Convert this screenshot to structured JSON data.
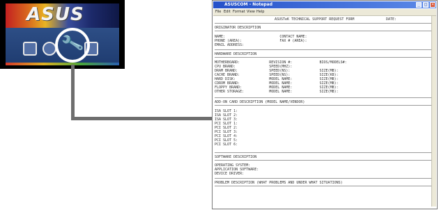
{
  "cd_menu": {
    "logo": "ASUS",
    "icons": [
      "drivers-icon",
      "disc-icon",
      "wrench-icon",
      "notes-icon"
    ]
  },
  "notepad": {
    "title": "ASUSCOM - Notepad",
    "menus": [
      "File",
      "Edit",
      "Format",
      "View",
      "Help"
    ],
    "doc": {
      "header": "ASUSTeK TECHNICAL SUPPORT REQUEST FORM",
      "date_label": "DATE:",
      "originator_title": "ORIGINATOR DESCRIPTION",
      "originator_fields": [
        "NAME:                          CONTACT NAME:",
        "PHONE (AREA):                  FAX # (AREA):",
        "EMAIL ADDRESS:"
      ],
      "hardware_title": "HARDWARE DESCRIPTION",
      "hardware_fields": [
        "MOTHERBOARD:              REVISION #:             BIOS/MODELS#:",
        "CPU BRAND:                SPEED(MHZ):",
        "DRAM BRAND:               SPEED(NS):              SIZE(MB):",
        "CACHE BRAND:              SPEED(NS):              SIZE(KB):",
        "HARD DISK:                MODEL NAME:             SIZE(MB):",
        "CDROM BRAND:              MODEL NAME:             SIZE(MB):",
        "FLOPPY BRAND:             MODEL NAME:             SIZE(MB):",
        "OTHER STORAGE:            MODEL NAME:             SIZE(MB):"
      ],
      "addon_title": "ADD-ON CARD DESCRIPTION (MODEL NAME/VENDOR)",
      "addon_fields": [
        "ISA SLOT 1:",
        "ISA SLOT 2:",
        "ISA SLOT 3:",
        "PCI SLOT 1:",
        "PCI SLOT 2:",
        "PCI SLOT 3:",
        "PCI SLOT 4:",
        "PCI SLOT 5:",
        "PCI SLOT 6:"
      ],
      "software_title": "SOFTWARE DESCRIPTION",
      "software_fields": [
        "OPERATING SYSTEM:",
        "APPLICATION SOFTWARE:",
        "DEVICE DRIVER:"
      ],
      "problem_title": "PROBLEM DESCRIPTION (WHAT PROBLEMS AND UNDER WHAT SITUATIONS)"
    }
  }
}
